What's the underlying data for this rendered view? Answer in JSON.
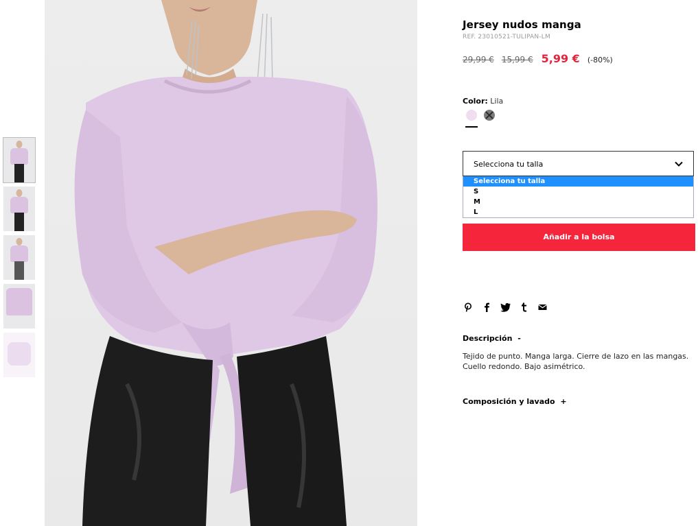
{
  "product": {
    "title": "Jersey nudos manga",
    "ref": "REF. 23010521-TULIPAN-LM",
    "price_original": "29,99 €",
    "price_previous": "15,99 €",
    "price_current": "5,99 €",
    "discount": "(-80%)"
  },
  "color": {
    "label": "Color:",
    "value": "Lila",
    "swatches": [
      {
        "name": "Lila",
        "color": "#efddf0",
        "selected": true
      },
      {
        "name": "Gris",
        "color": "#7a7a7a",
        "selected": false,
        "unavailable": true
      }
    ]
  },
  "size": {
    "select_label": "Selecciona tu talla",
    "options": [
      "Selecciona tu talla",
      "S",
      "M",
      "L"
    ],
    "selected_index": 0
  },
  "cart": {
    "add_label": "Añadir a la bolsa",
    "accent": "#f5263c"
  },
  "social": [
    "pinterest-icon",
    "facebook-icon",
    "twitter-icon",
    "tumblr-icon",
    "email-icon"
  ],
  "description": {
    "heading": "Descripción",
    "toggle": "-",
    "text": "Tejido de punto. Manga larga. Cierre de lazo en las mangas. Cuello redondo. Bajo asimétrico."
  },
  "composition": {
    "heading": "Composición y lavado",
    "toggle": "+"
  }
}
